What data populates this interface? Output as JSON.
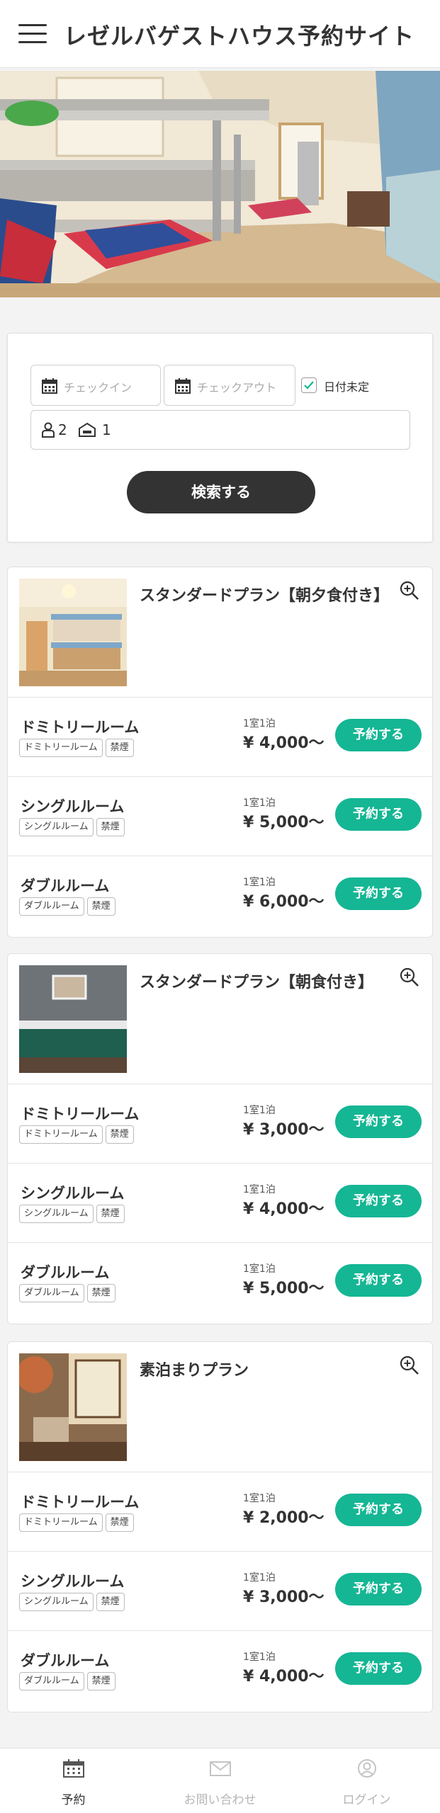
{
  "header": {
    "title": "レゼルバゲストハウス予約サイト",
    "menu_icon": "hamburger-menu-icon"
  },
  "search": {
    "checkin_placeholder": "チェックイン",
    "checkout_placeholder": "チェックアウト",
    "date_undecided_label": "日付未定",
    "date_undecided_checked": true,
    "guests": "2",
    "rooms": "1",
    "button_label": "検索する"
  },
  "plans": [
    {
      "title": "スタンダードプラン【朝夕食付き】",
      "rooms": [
        {
          "name": "ドミトリールーム",
          "tags": [
            "ドミトリールーム",
            "禁煙"
          ],
          "per_night": "1室1泊",
          "price": "¥ 4,000〜",
          "button": "予約する"
        },
        {
          "name": "シングルルーム",
          "tags": [
            "シングルルーム",
            "禁煙"
          ],
          "per_night": "1室1泊",
          "price": "¥ 5,000〜",
          "button": "予約する"
        },
        {
          "name": "ダブルルーム",
          "tags": [
            "ダブルルーム",
            "禁煙"
          ],
          "per_night": "1室1泊",
          "price": "¥ 6,000〜",
          "button": "予約する"
        }
      ]
    },
    {
      "title": "スタンダードプラン【朝食付き】",
      "rooms": [
        {
          "name": "ドミトリールーム",
          "tags": [
            "ドミトリールーム",
            "禁煙"
          ],
          "per_night": "1室1泊",
          "price": "¥ 3,000〜",
          "button": "予約する"
        },
        {
          "name": "シングルルーム",
          "tags": [
            "シングルルーム",
            "禁煙"
          ],
          "per_night": "1室1泊",
          "price": "¥ 4,000〜",
          "button": "予約する"
        },
        {
          "name": "ダブルルーム",
          "tags": [
            "ダブルルーム",
            "禁煙"
          ],
          "per_night": "1室1泊",
          "price": "¥ 5,000〜",
          "button": "予約する"
        }
      ]
    },
    {
      "title": "素泊まりプラン",
      "rooms": [
        {
          "name": "ドミトリールーム",
          "tags": [
            "ドミトリールーム",
            "禁煙"
          ],
          "per_night": "1室1泊",
          "price": "¥ 2,000〜",
          "button": "予約する"
        },
        {
          "name": "シングルルーム",
          "tags": [
            "シングルルーム",
            "禁煙"
          ],
          "per_night": "1室1泊",
          "price": "¥ 3,000〜",
          "button": "予約する"
        },
        {
          "name": "ダブルルーム",
          "tags": [
            "ダブルルーム",
            "禁煙"
          ],
          "per_night": "1室1泊",
          "price": "¥ 4,000〜",
          "button": "予約する"
        }
      ]
    }
  ],
  "bottom_nav": [
    {
      "label": "予約",
      "icon": "calendar-icon",
      "active": true
    },
    {
      "label": "お問い合わせ",
      "icon": "mail-icon",
      "active": false
    },
    {
      "label": "ログイン",
      "icon": "user-icon",
      "active": false
    }
  ],
  "colors": {
    "accent": "#15b694",
    "dark_button": "#333333",
    "text": "#333333"
  }
}
